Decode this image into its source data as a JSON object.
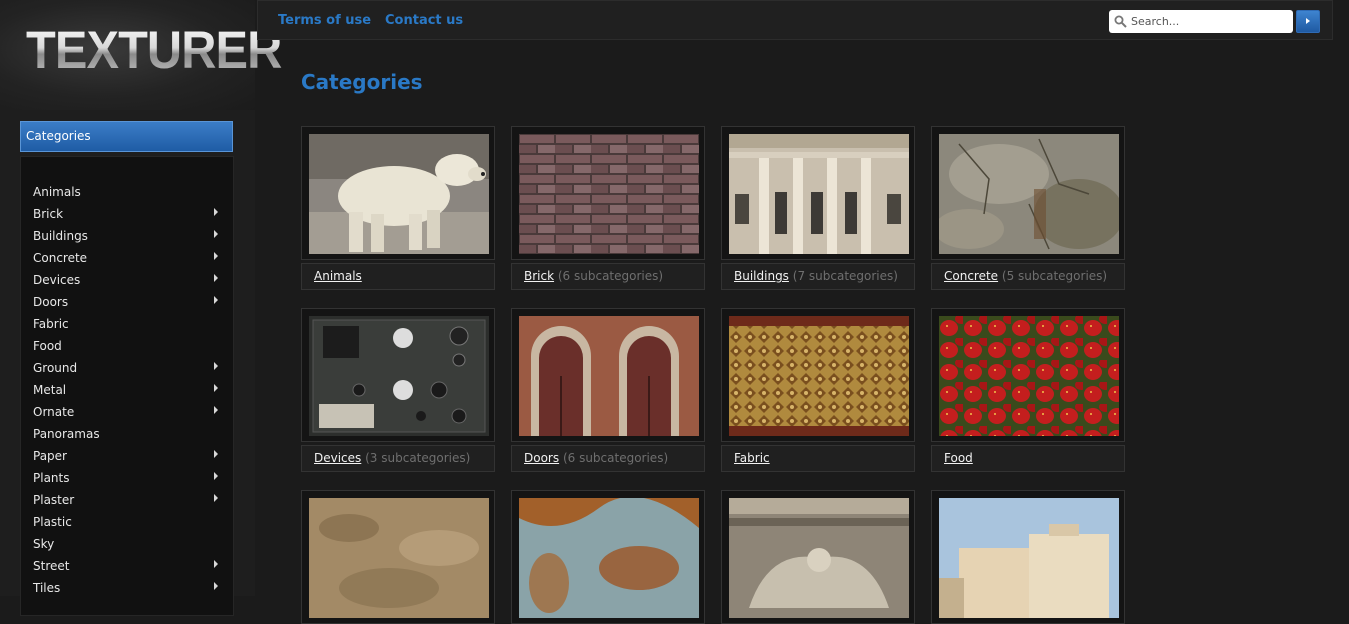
{
  "logo": {
    "text": "TEXTURER"
  },
  "topbar": {
    "links": [
      "Terms of use",
      "Contact us"
    ],
    "search": {
      "placeholder": "Search..."
    }
  },
  "sidebar": {
    "header": "Categories",
    "items": [
      {
        "label": "Animals",
        "has_children": false
      },
      {
        "label": "Brick",
        "has_children": true
      },
      {
        "label": "Buildings",
        "has_children": true
      },
      {
        "label": "Concrete",
        "has_children": true
      },
      {
        "label": "Devices",
        "has_children": true
      },
      {
        "label": "Doors",
        "has_children": true
      },
      {
        "label": "Fabric",
        "has_children": false
      },
      {
        "label": "Food",
        "has_children": false
      },
      {
        "label": "Ground",
        "has_children": true
      },
      {
        "label": "Metal",
        "has_children": true
      },
      {
        "label": "Ornate",
        "has_children": true
      },
      {
        "label": "Panoramas",
        "has_children": false
      },
      {
        "label": "Paper",
        "has_children": true
      },
      {
        "label": "Plants",
        "has_children": true
      },
      {
        "label": "Plaster",
        "has_children": true
      },
      {
        "label": "Plastic",
        "has_children": false
      },
      {
        "label": "Sky",
        "has_children": false
      },
      {
        "label": "Street",
        "has_children": true
      },
      {
        "label": "Tiles",
        "has_children": true
      }
    ]
  },
  "main": {
    "title": "Categories",
    "tiles": [
      {
        "name": "Animals",
        "sub": "",
        "image": "polar-bear"
      },
      {
        "name": "Brick",
        "sub": "(6 subcategories)",
        "image": "brick-wall"
      },
      {
        "name": "Buildings",
        "sub": "(7 subcategories)",
        "image": "building-facade"
      },
      {
        "name": "Concrete",
        "sub": "(5 subcategories)",
        "image": "concrete-wall"
      },
      {
        "name": "Devices",
        "sub": "(3 subcategories)",
        "image": "control-panel"
      },
      {
        "name": "Doors",
        "sub": "(6 subcategories)",
        "image": "arched-doors"
      },
      {
        "name": "Fabric",
        "sub": "",
        "image": "patterned-fabric"
      },
      {
        "name": "Food",
        "sub": "",
        "image": "strawberries"
      },
      {
        "name": "",
        "sub": "",
        "image": "ground-soil"
      },
      {
        "name": "",
        "sub": "",
        "image": "rusty-metal"
      },
      {
        "name": "",
        "sub": "",
        "image": "ornate-relief"
      },
      {
        "name": "",
        "sub": "",
        "image": "city-panorama"
      }
    ]
  },
  "colors": {
    "accent": "#2a79c6",
    "background": "#1b1b1b",
    "subtext": "#6f6f6f"
  }
}
